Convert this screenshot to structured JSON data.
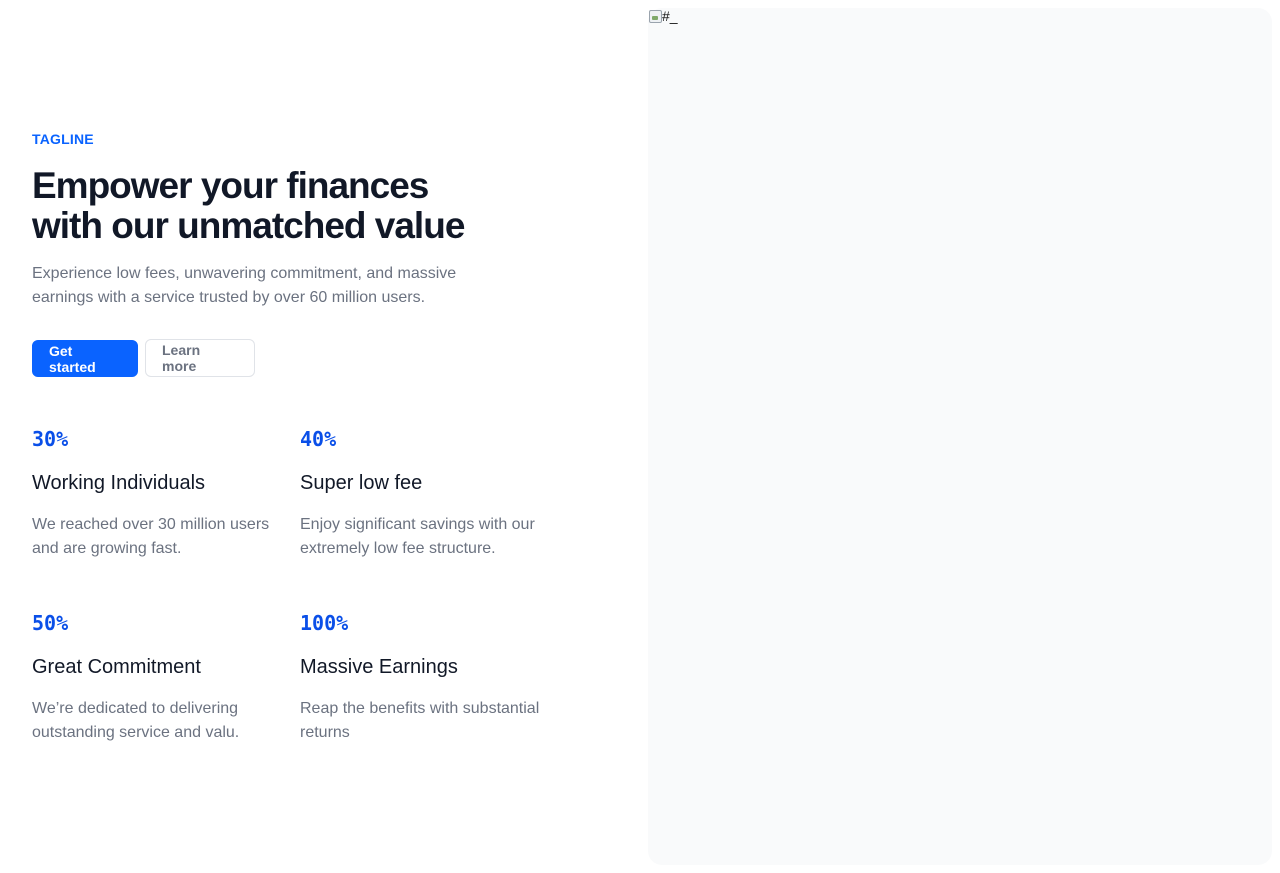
{
  "hero": {
    "tagline": "TAGLINE",
    "headline_line1": "Empower your finances",
    "headline_line2": "with our unmatched value",
    "description": "Experience low fees, unwavering commitment, and massive earnings with a service trusted by over 60 million users.",
    "primary_button": "Get started",
    "secondary_button": "Learn more"
  },
  "stats": [
    {
      "value": "30%",
      "title": "Working Individuals",
      "text": "We reached over 30 million users and are growing fast."
    },
    {
      "value": "40%",
      "title": "Super low fee",
      "text": "Enjoy significant savings with our extremely low fee structure."
    },
    {
      "value": "50%",
      "title": "Great Commitment",
      "text": "We’re dedicated to delivering outstanding service and valu."
    },
    {
      "value": "100%",
      "title": "Massive Earnings",
      "text": "Reap the benefits with substantial returns"
    }
  ],
  "media": {
    "alt_text": "#_"
  },
  "colors": {
    "accent": "#0a63ff",
    "stat_value": "#0a4fe8",
    "heading": "#111827",
    "muted": "#6b7280",
    "panel": "#f9fafb"
  }
}
